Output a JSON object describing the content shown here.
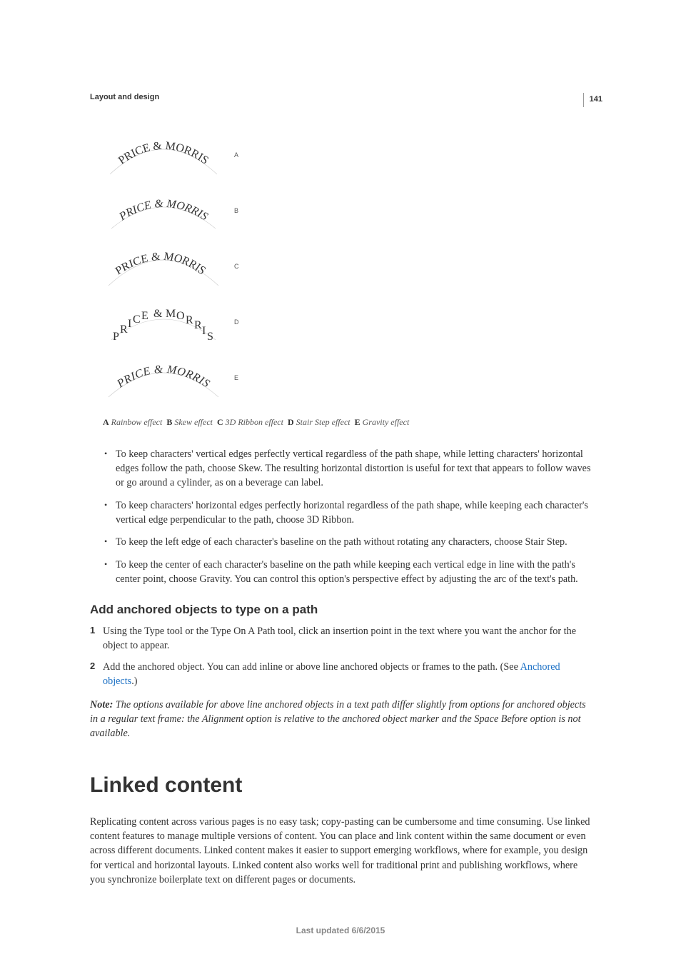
{
  "page_number": "141",
  "section_header": "Layout and design",
  "figure": {
    "text": "PRICE & MORRIS",
    "labels": {
      "a": "A",
      "b": "B",
      "c": "C",
      "d": "D",
      "e": "E"
    }
  },
  "caption": {
    "a_key": "A",
    "a_val": "Rainbow effect",
    "b_key": "B",
    "b_val": "Skew effect",
    "c_key": "C",
    "c_val": "3D Ribbon effect",
    "d_key": "D",
    "d_val": "Stair Step effect",
    "e_key": "E",
    "e_val": "Gravity effect"
  },
  "bullets": [
    "To keep characters' vertical edges perfectly vertical regardless of the path shape, while letting characters' horizontal edges follow the path, choose Skew. The resulting horizontal distortion is useful for text that appears to follow waves or go around a cylinder, as on a beverage can label.",
    "To keep characters' horizontal edges perfectly horizontal regardless of the path shape, while keeping each character's vertical edge perpendicular to the path, choose 3D Ribbon.",
    "To keep the left edge of each character's baseline on the path without rotating any characters, choose Stair Step.",
    "To keep the center of each character's baseline on the path while keeping each vertical edge in line with the path's center point, choose Gravity. You can control this option's perspective effect by adjusting the arc of the text's path."
  ],
  "subhead": "Add anchored objects to type on a path",
  "steps": {
    "s1": "Using the Type tool or the Type On A Path tool, click an insertion point in the text where you want the anchor for the object to appear.",
    "s2_a": "Add the anchored object. You can add inline or above line anchored objects or frames to the path. (See ",
    "s2_link": "Anchored objects",
    "s2_b": ".)"
  },
  "note": {
    "label": "Note: ",
    "text": "The options available for above line anchored objects in a text path differ slightly from options for anchored objects in a regular text frame: the Alignment option is relative to the anchored object marker and the Space Before option is not available."
  },
  "major_heading": "Linked content",
  "body_para": "Replicating content across various pages is no easy task; copy-pasting can be cumbersome and time consuming. Use linked content features to manage multiple versions of content. You can place and link content within the same document or even across different documents. Linked content makes it easier to support emerging workflows, where for example, you design for vertical and horizontal layouts. Linked content also works well for traditional print and publishing workflows, where you synchronize boilerplate text on different pages or documents.",
  "footer": "Last updated 6/6/2015"
}
